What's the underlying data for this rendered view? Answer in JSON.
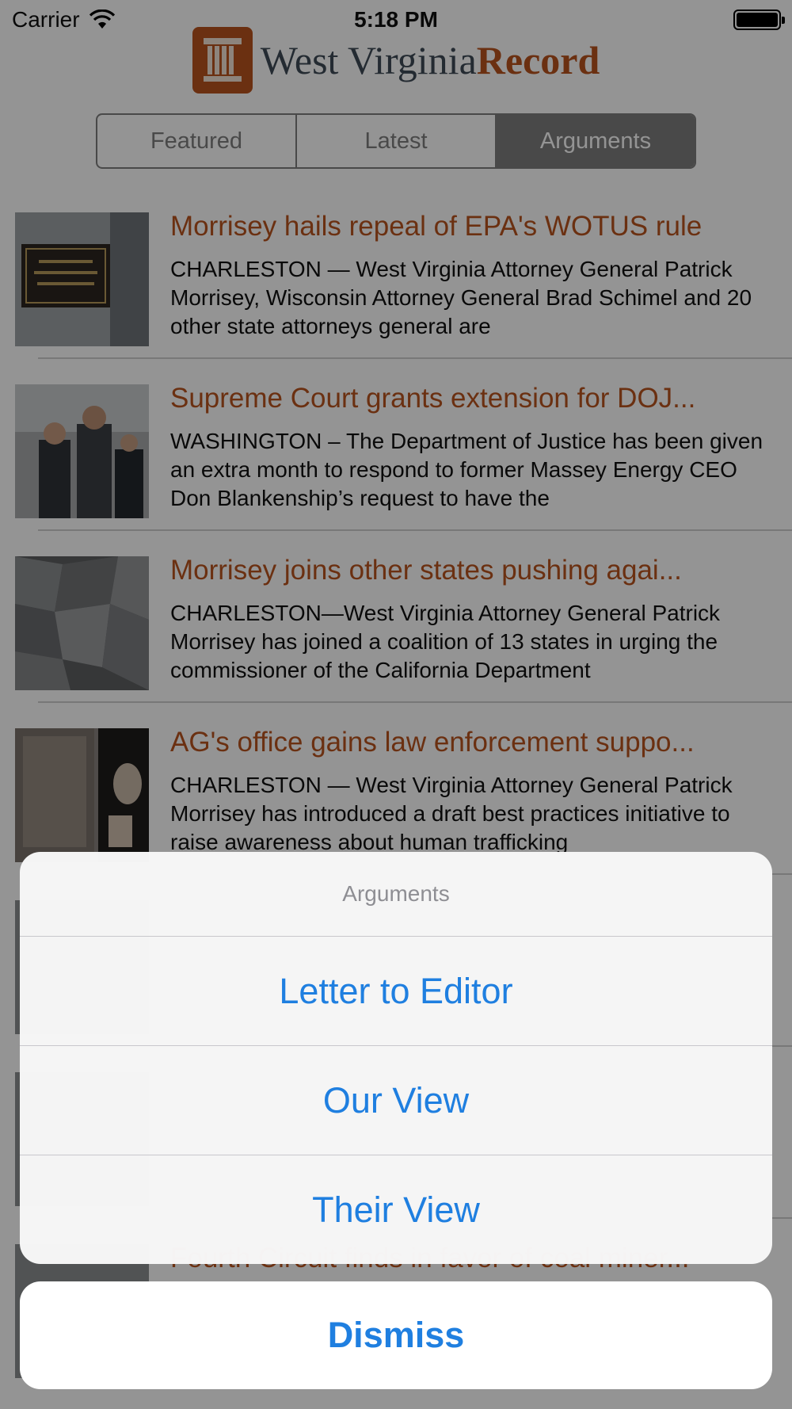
{
  "status_bar": {
    "carrier": "Carrier",
    "time": "5:18 PM"
  },
  "header": {
    "logo_text_primary": "West Virginia",
    "logo_text_accent": "Record",
    "tabs": [
      {
        "label": "Featured",
        "active": false
      },
      {
        "label": "Latest",
        "active": false
      },
      {
        "label": "Arguments",
        "active": true
      }
    ]
  },
  "articles": [
    {
      "title": "Morrisey hails repeal of EPA's WOTUS rule",
      "summary": "CHARLESTON — West Virginia Attorney General Patrick Morrisey, Wisconsin Attorney General Brad Schimel and 20 other state attorneys general are"
    },
    {
      "title": "Supreme Court grants extension for DOJ...",
      "summary": "WASHINGTON – The Department of Justice has been given an extra month to respond to former Massey Energy CEO Don Blankenship’s request to have the"
    },
    {
      "title": "Morrisey joins other states pushing agai...",
      "summary": "CHARLESTON—West Virginia Attorney General Patrick Morrisey has joined a coalition of 13 states in urging the commissioner of the California Department"
    },
    {
      "title": "AG's office gains law enforcement suppo...",
      "summary": "CHARLESTON — West Virginia Attorney General Patrick Morrisey has introduced a draft best practices initiative to raise awareness about human trafficking"
    },
    {
      "title": "",
      "summary": ""
    },
    {
      "title": "",
      "summary": ""
    },
    {
      "title": "Fourth Circuit finds in favor of coal miner...",
      "summary": ""
    }
  ],
  "action_sheet": {
    "title": "Arguments",
    "actions": [
      {
        "label": "Letter to Editor"
      },
      {
        "label": "Our View"
      },
      {
        "label": "Their View"
      }
    ],
    "dismiss_label": "Dismiss"
  },
  "colors": {
    "brand_orange": "#b8541e",
    "ios_blue": "#1f7fe0",
    "segment_gray": "#7f7f7f"
  }
}
